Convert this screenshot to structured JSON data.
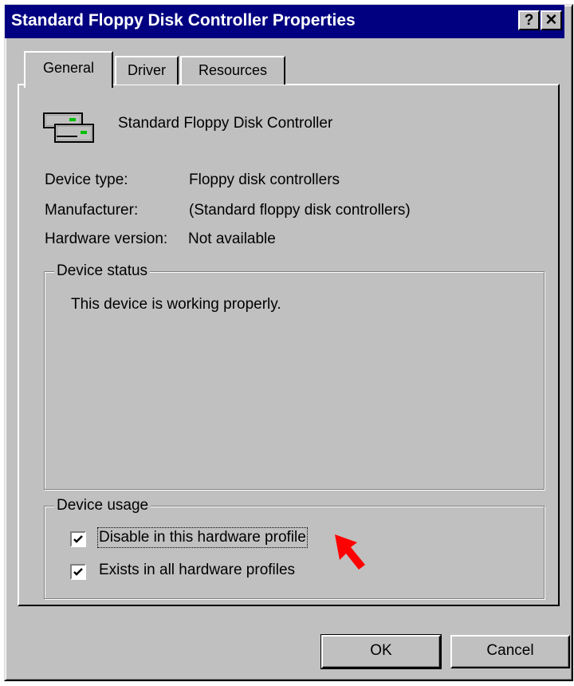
{
  "window": {
    "title": "Standard Floppy Disk Controller Properties",
    "help_button": "?",
    "close_button": "✕"
  },
  "tabs": [
    {
      "label": "General",
      "active": true
    },
    {
      "label": "Driver",
      "active": false
    },
    {
      "label": "Resources",
      "active": false
    }
  ],
  "device": {
    "icon": "floppy-controller-icon",
    "name": "Standard Floppy Disk Controller"
  },
  "properties": {
    "device_type_label": "Device type:",
    "device_type_value": "Floppy disk controllers",
    "manufacturer_label": "Manufacturer:",
    "manufacturer_value": "(Standard floppy disk controllers)",
    "hardware_version_label": "Hardware version:",
    "hardware_version_value": "Not available"
  },
  "device_status": {
    "title": "Device status",
    "text": "This device is working properly."
  },
  "device_usage": {
    "title": "Device usage",
    "options": [
      {
        "label": "Disable in this hardware profile",
        "checked": true
      },
      {
        "label": "Exists in all hardware profiles",
        "checked": true
      }
    ]
  },
  "buttons": {
    "ok": "OK",
    "cancel": "Cancel"
  },
  "colors": {
    "title_bar": "#000080",
    "face": "#c0c0c0",
    "annotation_arrow": "#ff0000"
  }
}
